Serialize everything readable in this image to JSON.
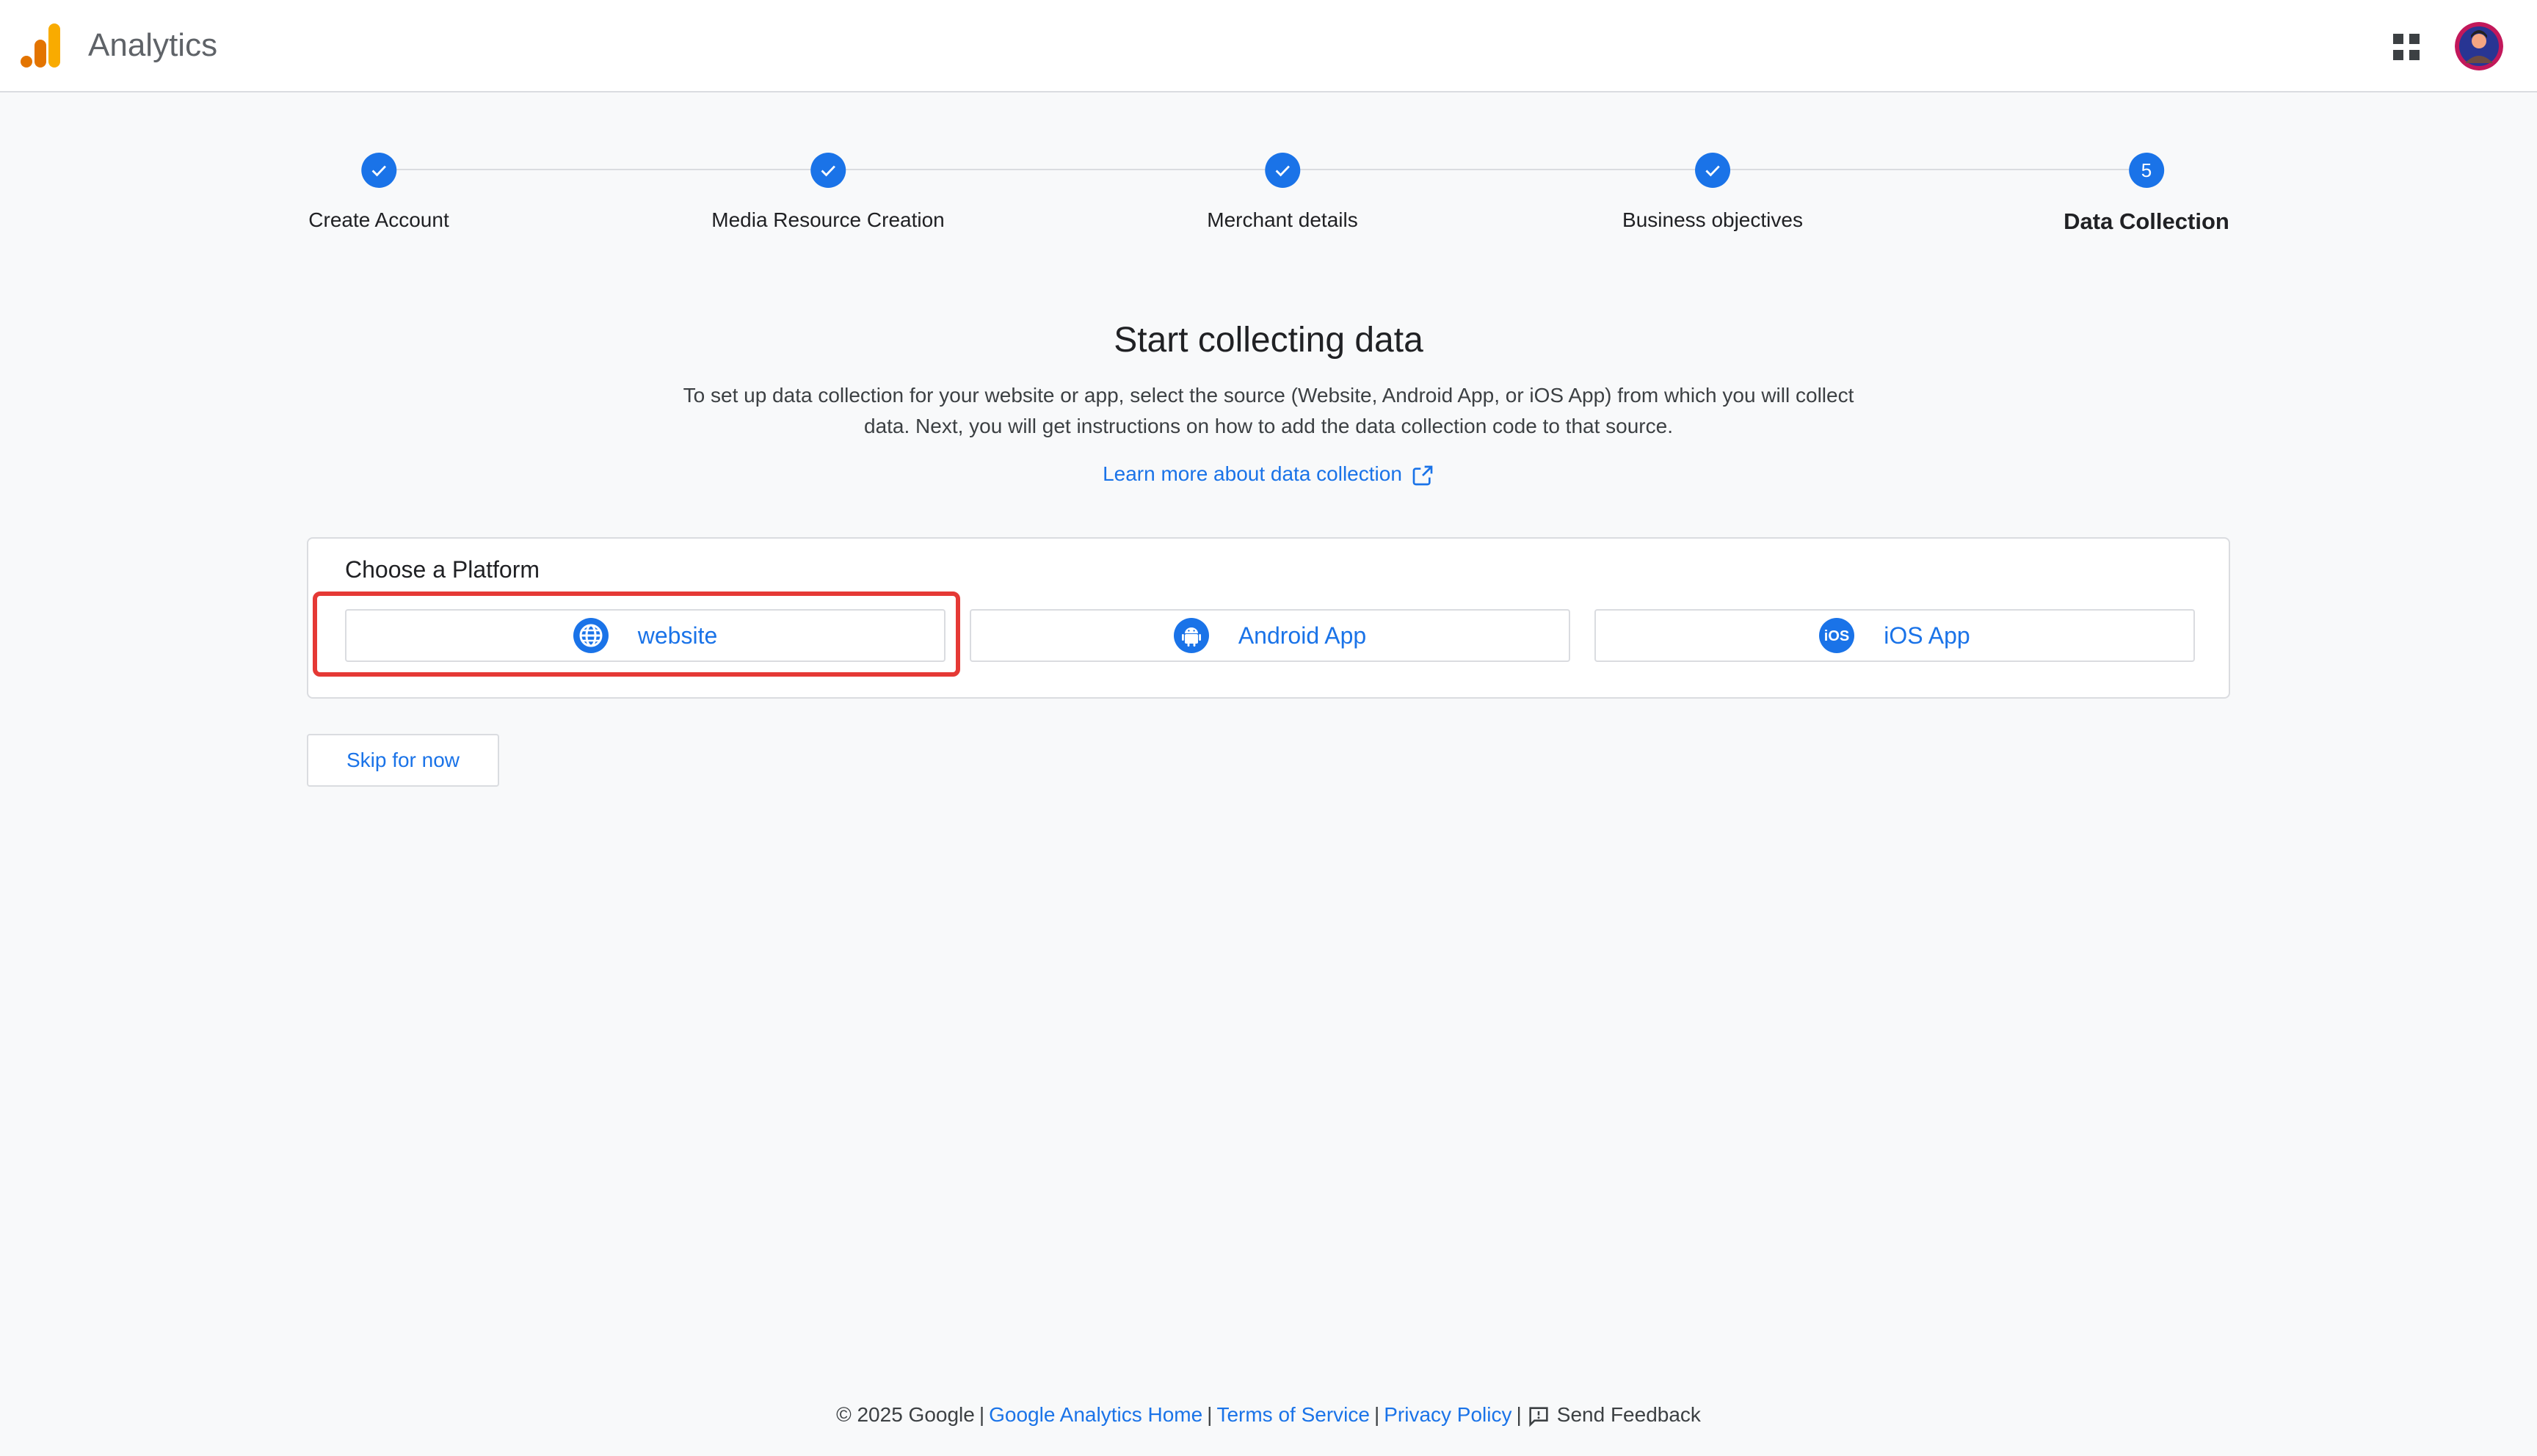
{
  "app": {
    "title": "Analytics",
    "logo_icon": "analytics-logo-icon",
    "apps_icon": "apps-grid-icon",
    "avatar_icon": "user-avatar"
  },
  "stepper": {
    "steps": [
      {
        "label": "Create Account",
        "status": "complete"
      },
      {
        "label": "Media Resource Creation",
        "status": "complete"
      },
      {
        "label": "Merchant details",
        "status": "complete"
      },
      {
        "label": "Business objectives",
        "status": "complete"
      },
      {
        "label": "Data Collection",
        "status": "current",
        "number": "5"
      }
    ]
  },
  "main": {
    "title": "Start collecting data",
    "description": "To set up data collection for your website or app, select the source (Website, Android App, or iOS App) from which you will collect data. Next, you will get instructions on how to add the data collection code to that source.",
    "learn_more": "Learn more about data collection"
  },
  "platform": {
    "title": "Choose a Platform",
    "options": [
      {
        "label": "website",
        "icon": "globe-icon"
      },
      {
        "label": "Android App",
        "icon": "android-icon"
      },
      {
        "label": "iOS App",
        "icon": "ios-icon"
      }
    ]
  },
  "skip_label": "Skip for now",
  "footer": {
    "copyright": "© 2025 Google",
    "links": [
      "Google Analytics Home",
      "Terms of Service",
      "Privacy Policy"
    ],
    "feedback": "Send Feedback"
  },
  "colors": {
    "accent": "#1a73e8",
    "highlight": "#e53935",
    "background": "#f8f9fa"
  }
}
